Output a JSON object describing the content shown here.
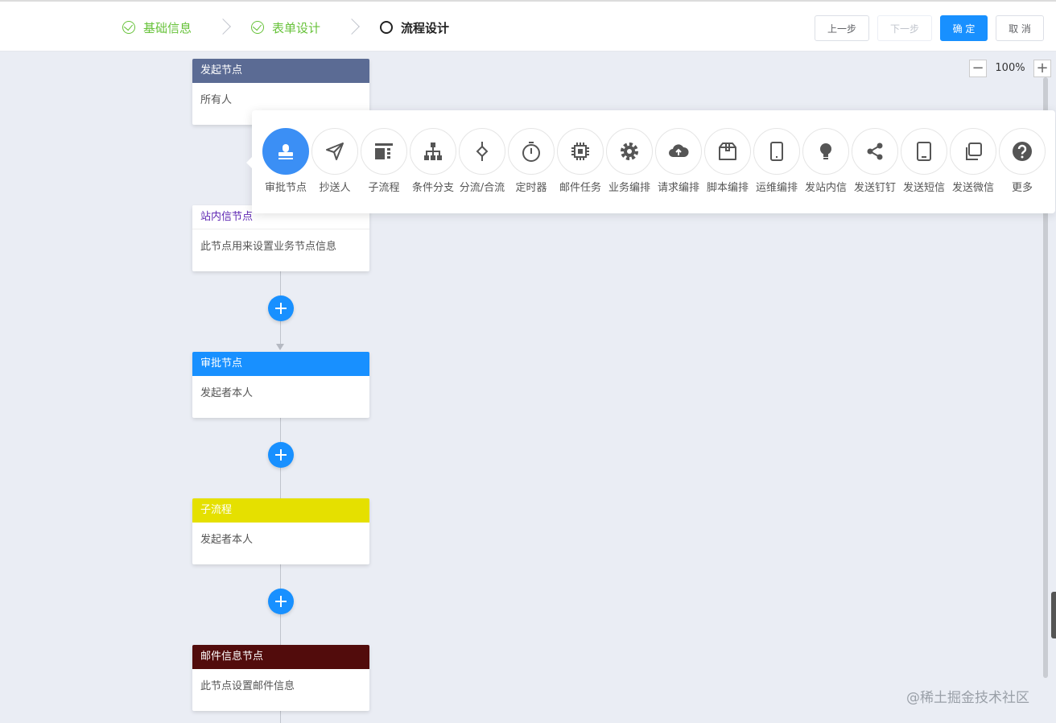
{
  "steps": [
    {
      "label": "基础信息",
      "state": "done"
    },
    {
      "label": "表单设计",
      "state": "done"
    },
    {
      "label": "流程设计",
      "state": "active"
    }
  ],
  "buttons": {
    "prev": "上一步",
    "next": "下一步",
    "confirm": "确 定",
    "cancel": "取 消"
  },
  "zoom": {
    "minus": "−",
    "plus": "+",
    "value": "100%"
  },
  "nodes": [
    {
      "title": "发起节点",
      "body": "所有人",
      "color": "#5b6b94"
    },
    {
      "title": "站内信节点",
      "body": "此节点用来设置业务节点信息",
      "color": "#ffffff"
    },
    {
      "title": "审批节点",
      "body": "发起者本人",
      "color": "#1890ff"
    },
    {
      "title": "子流程",
      "body": "发起者本人",
      "color": "#e5e000"
    },
    {
      "title": "邮件信息节点",
      "body": "此节点设置邮件信息",
      "color": "#520c0c"
    }
  ],
  "tools": [
    {
      "label": "审批节点",
      "icon": "stamp-icon"
    },
    {
      "label": "抄送人",
      "icon": "send-icon"
    },
    {
      "label": "子流程",
      "icon": "subprocess-icon"
    },
    {
      "label": "条件分支",
      "icon": "org-tree-icon"
    },
    {
      "label": "分流/合流",
      "icon": "diamond-split-icon"
    },
    {
      "label": "定时器",
      "icon": "timer-icon"
    },
    {
      "label": "邮件任务",
      "icon": "chip-icon"
    },
    {
      "label": "业务编排",
      "icon": "gear-icon"
    },
    {
      "label": "请求编排",
      "icon": "cloud-upload-icon"
    },
    {
      "label": "脚本编排",
      "icon": "box-icon"
    },
    {
      "label": "运维编排",
      "icon": "tablet-icon"
    },
    {
      "label": "发站内信",
      "icon": "bulb-icon"
    },
    {
      "label": "发送钉钉",
      "icon": "share-icon"
    },
    {
      "label": "发送短信",
      "icon": "phone-icon"
    },
    {
      "label": "发送微信",
      "icon": "copy-icon"
    },
    {
      "label": "更多",
      "icon": "help-icon"
    }
  ],
  "colors": {
    "primary": "#1890ff",
    "success": "#67c23a",
    "canvas": "#eaedf4"
  },
  "watermark": "@稀土掘金技术社区"
}
